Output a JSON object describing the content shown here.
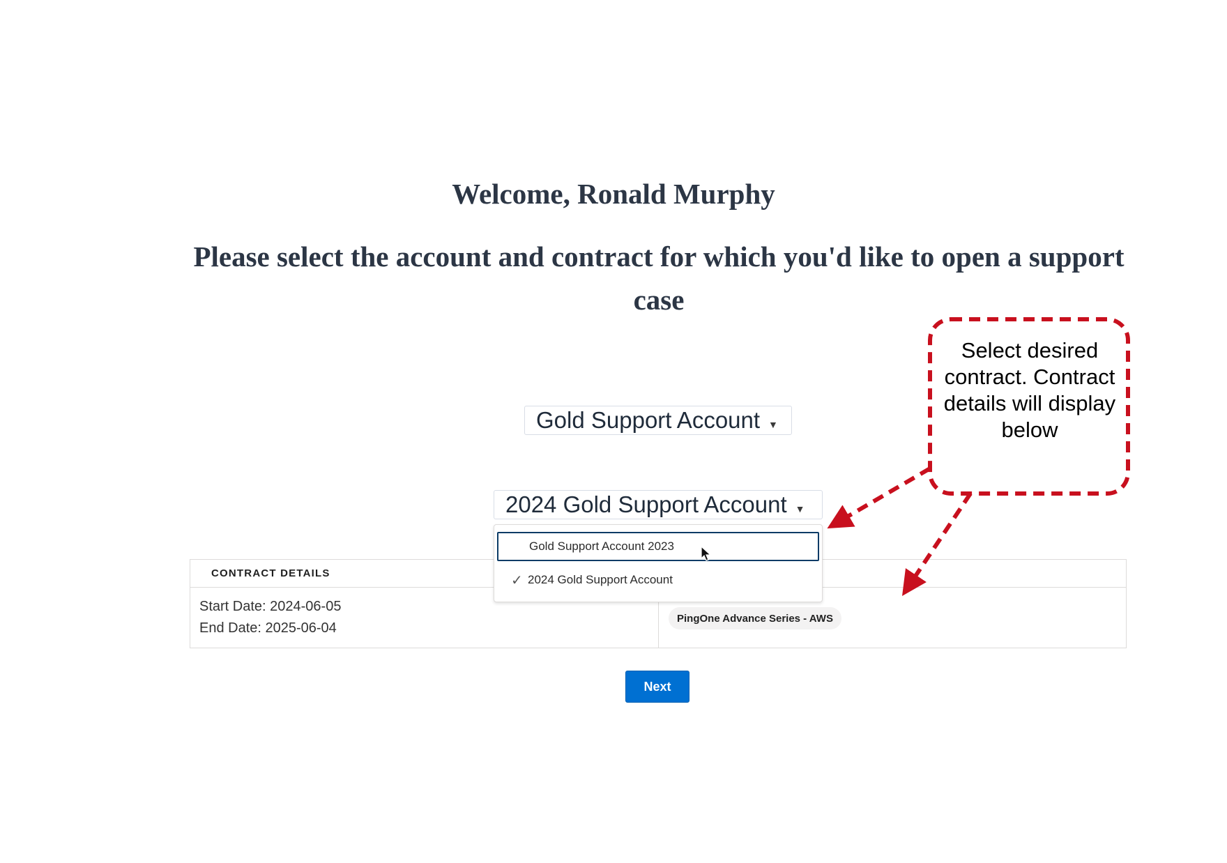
{
  "header": {
    "welcome": "Welcome, Ronald Murphy",
    "prompt": "Please select the account and contract for which you'd like to open a support case"
  },
  "account_select": {
    "value": "Gold Support Account"
  },
  "contract_select": {
    "value": "2024 Gold Support Account",
    "options": [
      {
        "label": "Gold Support Account 2023",
        "selected": false,
        "hovered": true
      },
      {
        "label": "2024 Gold Support Account",
        "selected": true,
        "hovered": false
      }
    ]
  },
  "contract_details": {
    "title": "CONTRACT DETAILS",
    "start_date": "Start Date: 2024-06-05",
    "end_date": "End Date: 2025-06-04",
    "product": "PingOne Advance Series - AWS"
  },
  "actions": {
    "next_label": "Next"
  },
  "annotation": {
    "text": "Select desired contract. Contract details will display below",
    "color": "#c8101e"
  },
  "colors": {
    "heading": "#2c3645",
    "primary_button": "#0070d2",
    "focus_border": "#0b3b66"
  },
  "icons": {
    "chevron": "chevron-down-icon",
    "check": "check-icon",
    "cursor": "mouse-pointer-icon"
  }
}
